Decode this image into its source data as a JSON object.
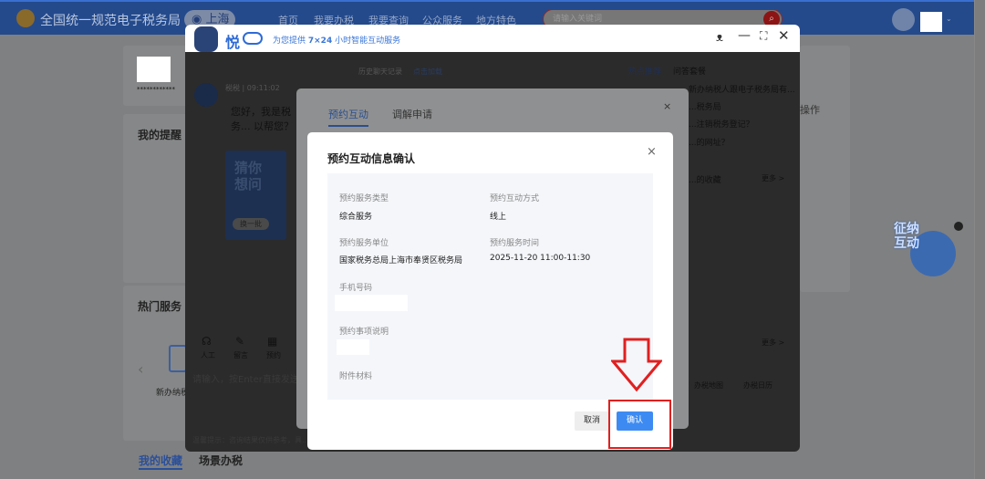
{
  "header": {
    "site_title": "全国统一规范电子税务局",
    "city": "上海",
    "nav": [
      "首页",
      "我要办税",
      "我要查询",
      "公众服务",
      "地方特色"
    ],
    "search_placeholder": "请输入关键词"
  },
  "page": {
    "masked_account": "************",
    "reminder_title": "我的提醒",
    "hot_services_title": "热门服务",
    "hot_item": "新办纳税",
    "tabs": [
      "我的收藏",
      "场景办税"
    ],
    "operate": "操作",
    "float_badge": "征纳互动"
  },
  "chat": {
    "brand": "悦",
    "tagline_prefix": "为您提供 ",
    "tagline_bold": "7×24",
    "tagline_suffix": " 小时智能互动服务",
    "history": "历史聊天记录",
    "load_more": "点击加载",
    "sender": "税税 | 09:11:02",
    "greeting": "您好，我是税务... 以帮您？",
    "guess_card": "猜你想问",
    "refresh": "换一批",
    "tools": [
      "人工",
      "留言",
      "预约"
    ],
    "input_placeholder": "请输入，按Enter直接发送",
    "footer_note": "温馨提示：咨询结果仅供参考，具...",
    "side_tabs": [
      "热点推荐",
      "问答套餐"
    ],
    "side_items": [
      "新办纳税人跟电子税务局有...",
      "...税务局",
      "...注销税务登记？",
      "...的网址？"
    ],
    "side_fav": "...的收藏",
    "more": "更多 >",
    "bottom_items": [
      "办税地图",
      "办税日历"
    ]
  },
  "inner_dialog": {
    "tabs": [
      "预约互动",
      "调解申请"
    ]
  },
  "modal": {
    "title": "预约互动信息确认",
    "fields": [
      {
        "label": "预约服务类型",
        "value": "综合服务"
      },
      {
        "label": "预约互动方式",
        "value": "线上"
      },
      {
        "label": "预约服务单位",
        "value": "国家税务总局上海市奉贤区税务局"
      },
      {
        "label": "预约服务时间",
        "value": "2025-11-20 11:00-11:30"
      },
      {
        "label": "手机号码",
        "value": ""
      },
      {
        "label": "预约事项说明",
        "value": ""
      },
      {
        "label": "附件材料",
        "value": ""
      }
    ],
    "cancel": "取消",
    "confirm": "确认"
  },
  "colors": {
    "primary": "#3d8bf2",
    "highlight": "#e02020"
  }
}
